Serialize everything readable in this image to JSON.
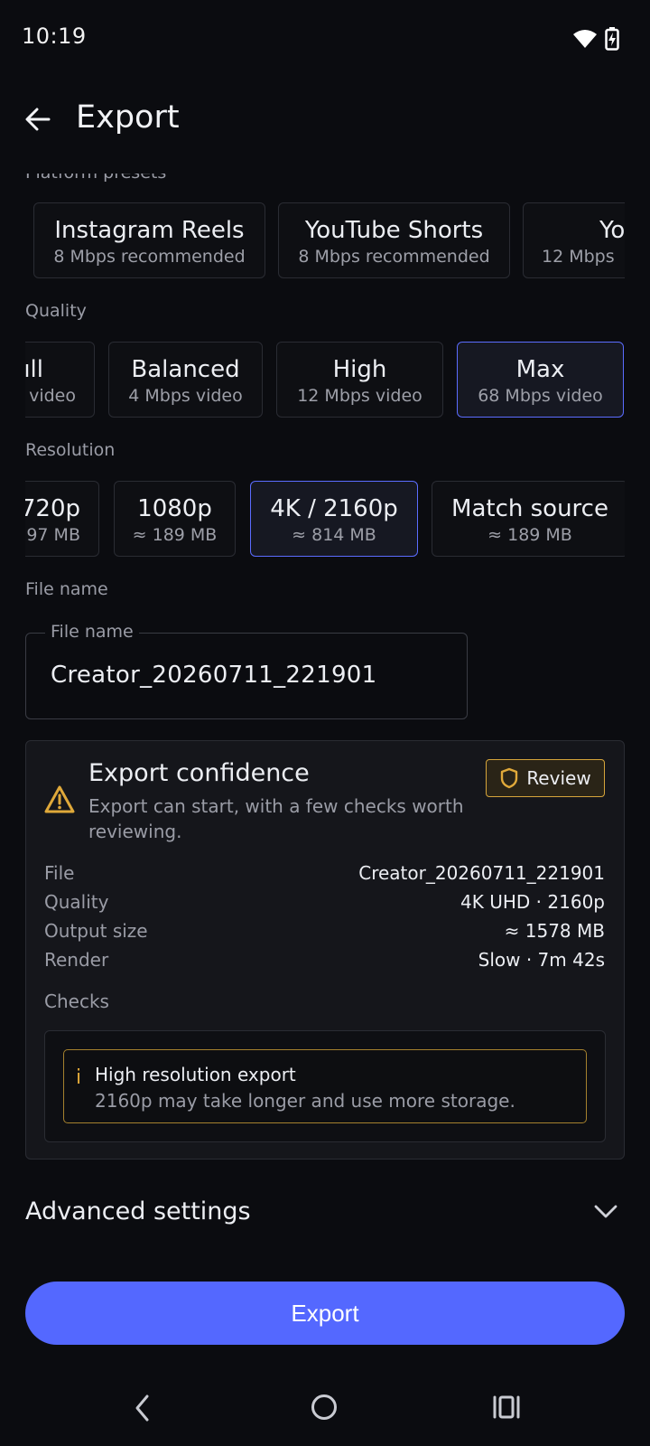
{
  "status_bar": {
    "time": "10:19",
    "icons": [
      "wifi-icon",
      "battery-charging-icon"
    ]
  },
  "header": {
    "title": "Export"
  },
  "platform_presets": {
    "label": "Platform presets",
    "items": [
      {
        "name": "Instagram Reels",
        "detail": "8 Mbps recommended"
      },
      {
        "name": "YouTube Shorts",
        "detail": "8 Mbps recommended"
      },
      {
        "name": "Yo",
        "detail": "12 Mbps"
      }
    ]
  },
  "quality": {
    "label": "Quality",
    "selected": "Max",
    "items": [
      {
        "name": "ıll",
        "detail": "video"
      },
      {
        "name": "Balanced",
        "detail": "4 Mbps video"
      },
      {
        "name": "High",
        "detail": "12 Mbps video"
      },
      {
        "name": "Max",
        "detail": "68 Mbps video"
      }
    ]
  },
  "resolution": {
    "label": "Resolution",
    "selected": "4K / 2160p",
    "items": [
      {
        "name": "720p",
        "detail": "97 MB"
      },
      {
        "name": "1080p",
        "detail": "≈ 189 MB"
      },
      {
        "name": "4K / 2160p",
        "detail": "≈ 814 MB"
      },
      {
        "name": "Match source",
        "detail": "≈ 189 MB"
      }
    ]
  },
  "file_name": {
    "section_label": "File name",
    "field_label": "File name",
    "value": "Creator_20260711_221901"
  },
  "confidence_card": {
    "title": "Export confidence",
    "description_line1": "Export can start, with a few checks worth",
    "description_line2": "reviewing.",
    "badge": "Review",
    "summary": [
      {
        "label": "File",
        "value": "Creator_20260711_221901"
      },
      {
        "label": "Quality",
        "value": "4K UHD · 2160p"
      },
      {
        "label": "Output size",
        "value": "≈ 1578 MB"
      },
      {
        "label": "Render",
        "value": "Slow · 7m 42s"
      }
    ],
    "checks_label": "Checks",
    "checks": [
      {
        "icon_glyph": "i",
        "title": "High resolution export",
        "detail": "2160p may take longer and use more storage."
      }
    ]
  },
  "advanced": {
    "label": "Advanced settings"
  },
  "export_button": {
    "label": "Export"
  },
  "colors": {
    "accent": "#5468ff",
    "warning": "#e0a93a",
    "background": "#0b0c10"
  }
}
